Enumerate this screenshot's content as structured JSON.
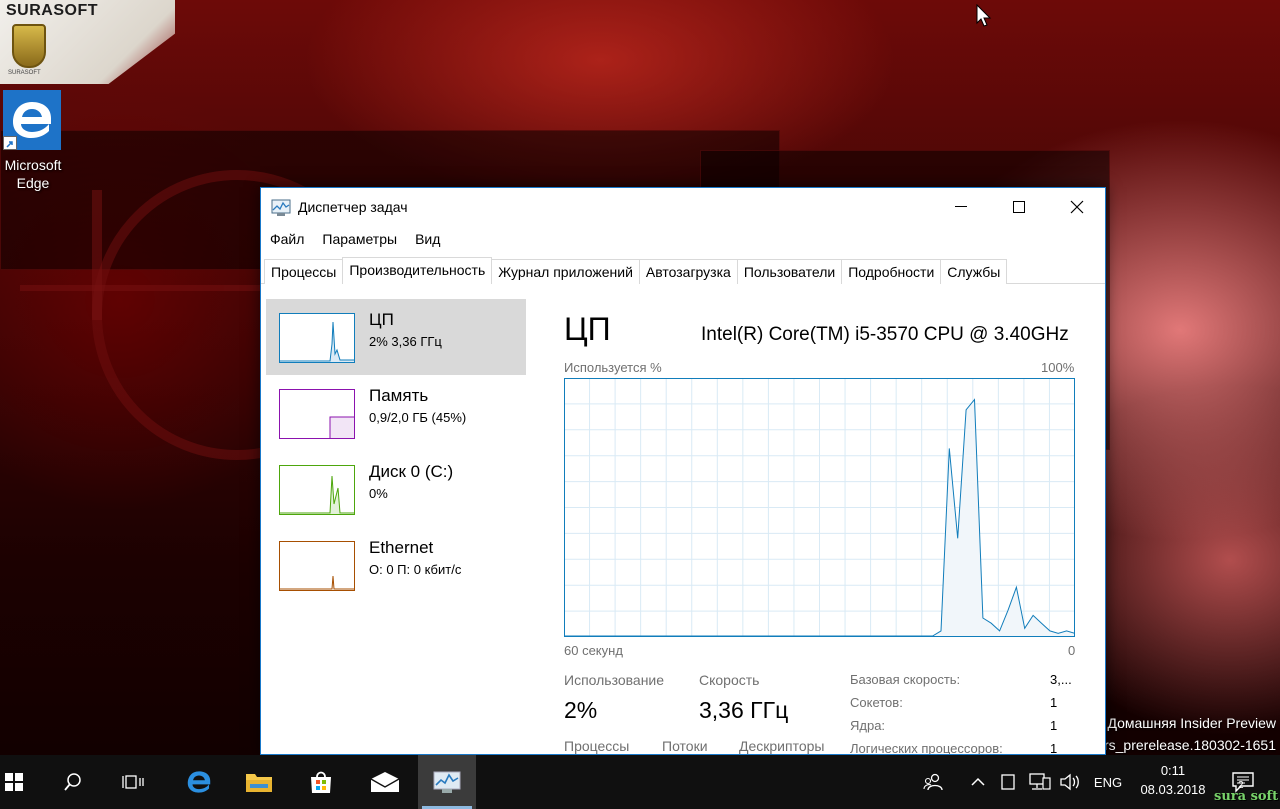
{
  "desktop": {
    "logo_text": "SURASOFT",
    "logo_sub": "SURASOFT",
    "icons": [
      {
        "label": "Microsoft Edge",
        "label_line1": "Microsoft",
        "label_line2": "Edge",
        "icon": "edge-icon"
      }
    ],
    "build_info_line1": "Домашняя Insider Preview",
    "build_info_line2": "rs_prerelease.180302-1651",
    "watermark": "sura soft"
  },
  "taskmgr": {
    "title": "Диспетчер задач",
    "menu": [
      "Файл",
      "Параметры",
      "Вид"
    ],
    "tabs": [
      "Процессы",
      "Производительность",
      "Журнал приложений",
      "Автозагрузка",
      "Пользователи",
      "Подробности",
      "Службы"
    ],
    "active_tab": "Производительность",
    "side_items": [
      {
        "name": "ЦП",
        "sub": "2% 3,36 ГГц",
        "color": "#117dbb",
        "selected": true
      },
      {
        "name": "Память",
        "sub": "0,9/2,0 ГБ (45%)",
        "color": "#8b12ae",
        "selected": false
      },
      {
        "name": "Диск 0 (C:)",
        "sub": "0%",
        "color": "#4da60c",
        "selected": false
      },
      {
        "name": "Ethernet",
        "sub": "О: 0 П: 0 кбит/с",
        "color": "#a74f01",
        "selected": false
      }
    ],
    "cpu": {
      "title": "ЦП",
      "model": "Intel(R) Core(TM) i5-3570 CPU @ 3.40GHz",
      "usage_axis_label": "Используется %",
      "max_label": "100%",
      "time_label": "60 секунд",
      "zero_label": "0",
      "graph_color": "#117dbb",
      "graph_fill": "#f1f6fa",
      "history_percent": [
        0,
        0,
        0,
        0,
        0,
        0,
        0,
        0,
        0,
        0,
        0,
        0,
        0,
        0,
        0,
        0,
        0,
        0,
        0,
        0,
        0,
        0,
        0,
        0,
        0,
        0,
        0,
        0,
        0,
        0,
        0,
        0,
        0,
        0,
        0,
        0,
        0,
        0,
        0,
        0,
        0,
        0,
        0,
        0,
        0,
        2,
        73,
        38,
        88,
        92,
        7,
        5,
        2,
        10,
        19,
        3,
        8,
        5,
        2,
        1,
        2,
        1
      ]
    },
    "stats": {
      "usage_label": "Использование",
      "usage_value": "2%",
      "speed_label": "Скорость",
      "speed_value": "3,36 ГГц",
      "processes_label": "Процессы",
      "threads_label": "Потоки",
      "handles_label": "Дескрипторы"
    },
    "specs": [
      {
        "label": "Базовая скорость:",
        "value": "3,..."
      },
      {
        "label": "Сокетов:",
        "value": "1"
      },
      {
        "label": "Ядра:",
        "value": "1"
      },
      {
        "label": "Логических процессоров:",
        "value": "1"
      }
    ]
  },
  "taskbar": {
    "lang": "ENG",
    "time": "0:11",
    "date": "08.03.2018",
    "notification_count": "2"
  }
}
